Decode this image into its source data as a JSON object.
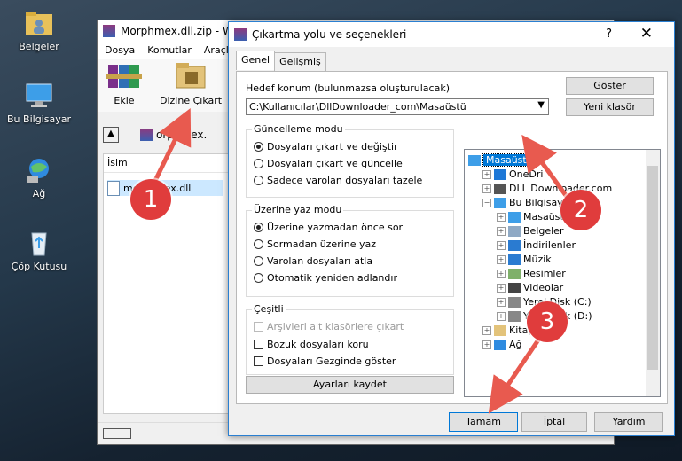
{
  "desktop": {
    "icons": [
      {
        "label": "Belgeler",
        "icon": "folder-user-icon"
      },
      {
        "label": "Bu Bilgisayar",
        "icon": "computer-icon"
      },
      {
        "label": "Ağ",
        "icon": "network-icon"
      },
      {
        "label": "Çöp Kutusu",
        "icon": "recycle-bin-icon"
      }
    ]
  },
  "winrar": {
    "title": "Morphmex.dll.zip - W",
    "menu": [
      "Dosya",
      "Komutlar",
      "Araçla"
    ],
    "tools": {
      "extract": "Ekle",
      "extract_to": "Dizine Çıkart"
    },
    "path": "orphmex.",
    "list_header": "İsim",
    "file": "morphmex.dll"
  },
  "dialog": {
    "title": "Çıkartma yolu ve seçenekleri",
    "help": "?",
    "close": "✕",
    "tabs": [
      "Genel",
      "Gelişmiş"
    ],
    "dest_label": "Hedef konum (bulunmazsa oluşturulacak)",
    "dest_value": "C:\\Kullanıcılar\\DllDownloader_com\\Masaüstü",
    "btn_show": "Göster",
    "btn_new_folder": "Yeni klasör",
    "update_mode": {
      "title": "Güncelleme modu",
      "options": [
        "Dosyaları çıkart ve değiştir",
        "Dosyaları çıkart ve güncelle",
        "Sadece varolan dosyaları tazele"
      ],
      "selected": 0
    },
    "overwrite_mode": {
      "title": "Üzerine yaz modu",
      "options": [
        "Üzerine yazmadan önce sor",
        "Sormadan üzerine yaz",
        "Varolan dosyaları atla",
        "Otomatik yeniden adlandır"
      ],
      "selected": 0
    },
    "misc": {
      "title": "Çeşitli",
      "options": [
        "Arşivleri alt klasörlere çıkart",
        "Bozuk dosyaları koru",
        "Dosyaları Gezginde göster"
      ]
    },
    "btn_save": "Ayarları kaydet",
    "tree": [
      {
        "label": "Masaüstü",
        "icon": "desktop-icon",
        "level": 0,
        "selected": true
      },
      {
        "label": "OneDri",
        "icon": "cloud-icon",
        "level": 1
      },
      {
        "label": "DLL Downloader.com",
        "icon": "user-icon",
        "level": 1
      },
      {
        "label": "Bu Bilgisayar",
        "icon": "computer-icon",
        "level": 1
      },
      {
        "label": "Masaüstü",
        "icon": "desktop-icon",
        "level": 2
      },
      {
        "label": "Belgeler",
        "icon": "documents-icon",
        "level": 2
      },
      {
        "label": "İndirilenler",
        "icon": "download-icon",
        "level": 2
      },
      {
        "label": "Müzik",
        "icon": "music-icon",
        "level": 2
      },
      {
        "label": "Resimler",
        "icon": "pictures-icon",
        "level": 2
      },
      {
        "label": "Videolar",
        "icon": "video-icon",
        "level": 2
      },
      {
        "label": "Yerel Disk (C:)",
        "icon": "disk-icon",
        "level": 2
      },
      {
        "label": "Yerel Disk (D:)",
        "icon": "disk-icon",
        "level": 2
      },
      {
        "label": "Kitaplıklar",
        "icon": "library-icon",
        "level": 1
      },
      {
        "label": "Ağ",
        "icon": "network-icon",
        "level": 1
      }
    ],
    "btn_ok": "Tamam",
    "btn_cancel": "İptal",
    "btn_help": "Yardım"
  },
  "annotations": [
    "1",
    "2",
    "3"
  ],
  "colors": {
    "accent": "#0078d7",
    "badge": "#e03c3c",
    "arrow": "#e85a4f"
  }
}
